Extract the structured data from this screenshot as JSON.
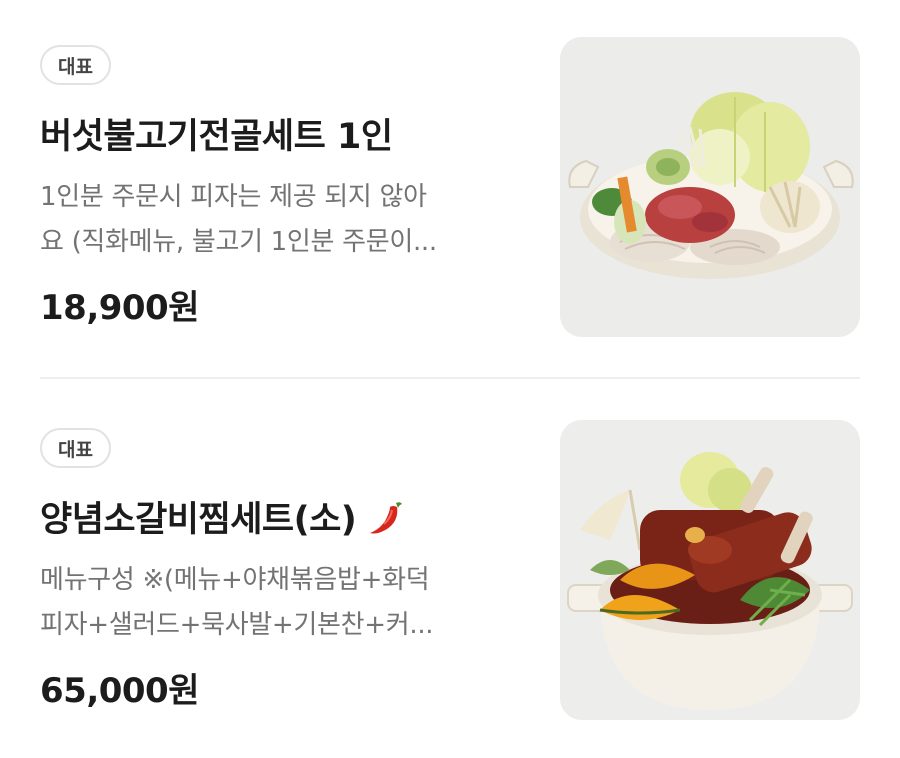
{
  "menu_items": [
    {
      "badge": "대표",
      "title": "버섯불고기전골세트 1인",
      "description_lines": [
        "1인분 주문시 피자는 제공 되지 않아",
        "요 (직화메뉴, 불고기 1인분 주문이..."
      ],
      "price": "18,900원",
      "image_icon": "mushroom-bulgogi-hotpot-photo"
    },
    {
      "badge": "대표",
      "title": "양념소갈비찜세트(소)",
      "spicy_icon": "chili-pepper-icon",
      "description_lines": [
        "메뉴구성 ※(메뉴+야채볶음밥+화덕",
        "피자+샐러드+묵사발+기본찬+커..."
      ],
      "price": "65,000원",
      "image_icon": "braised-short-ribs-photo"
    }
  ],
  "colors": {
    "title": "#1c1c1c",
    "description": "#737373",
    "badge_border": "#e2e2e2",
    "chili": "#d9261c"
  }
}
